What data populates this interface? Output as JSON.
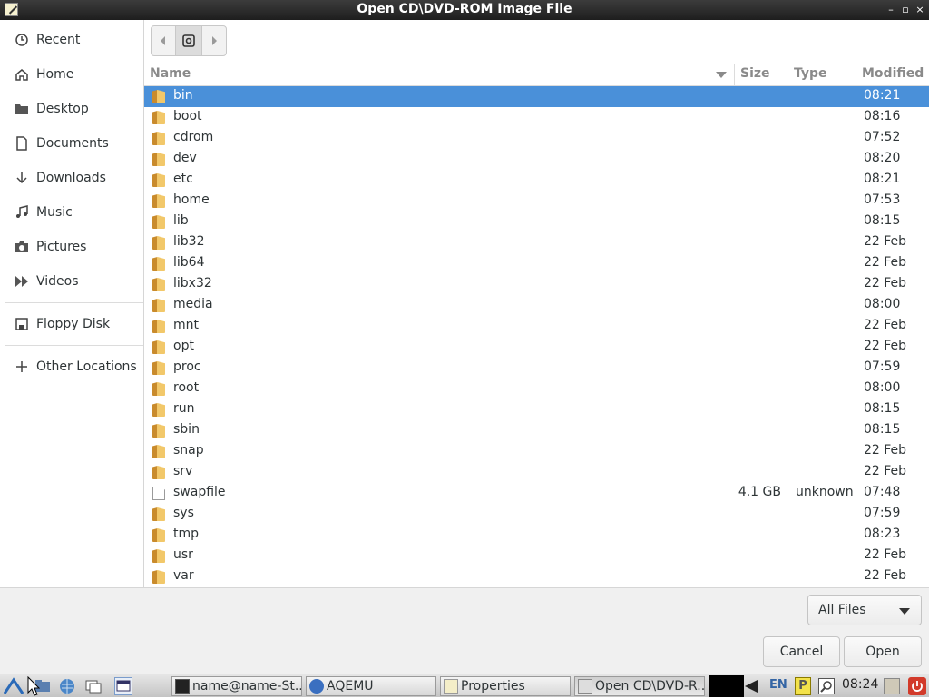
{
  "window": {
    "title": "Open CD\\DVD-ROM Image File",
    "controls": [
      "–",
      "▫",
      "×"
    ]
  },
  "sidebar": {
    "items": [
      {
        "label": "Recent",
        "icon": "clock-icon"
      },
      {
        "label": "Home",
        "icon": "home-icon"
      },
      {
        "label": "Desktop",
        "icon": "folder-icon"
      },
      {
        "label": "Documents",
        "icon": "document-icon"
      },
      {
        "label": "Downloads",
        "icon": "download-arrow-icon"
      },
      {
        "label": "Music",
        "icon": "music-note-icon"
      },
      {
        "label": "Pictures",
        "icon": "camera-icon"
      },
      {
        "label": "Videos",
        "icon": "video-icon"
      }
    ],
    "devices": [
      {
        "label": "Floppy Disk",
        "icon": "floppy-icon"
      }
    ],
    "other": {
      "label": "Other Locations",
      "icon": "plus-icon"
    }
  },
  "columns": {
    "name": "Name",
    "size": "Size",
    "type": "Type",
    "modified": "Modified"
  },
  "files": [
    {
      "name": "bin",
      "size": "",
      "type": "",
      "modified": "08:21",
      "kind": "folder",
      "selected": true
    },
    {
      "name": "boot",
      "size": "",
      "type": "",
      "modified": "08:16",
      "kind": "folder"
    },
    {
      "name": "cdrom",
      "size": "",
      "type": "",
      "modified": "07:52",
      "kind": "folder"
    },
    {
      "name": "dev",
      "size": "",
      "type": "",
      "modified": "08:20",
      "kind": "folder"
    },
    {
      "name": "etc",
      "size": "",
      "type": "",
      "modified": "08:21",
      "kind": "folder"
    },
    {
      "name": "home",
      "size": "",
      "type": "",
      "modified": "07:53",
      "kind": "folder"
    },
    {
      "name": "lib",
      "size": "",
      "type": "",
      "modified": "08:15",
      "kind": "folder"
    },
    {
      "name": "lib32",
      "size": "",
      "type": "",
      "modified": "22 Feb",
      "kind": "folder"
    },
    {
      "name": "lib64",
      "size": "",
      "type": "",
      "modified": "22 Feb",
      "kind": "folder"
    },
    {
      "name": "libx32",
      "size": "",
      "type": "",
      "modified": "22 Feb",
      "kind": "folder"
    },
    {
      "name": "media",
      "size": "",
      "type": "",
      "modified": "08:00",
      "kind": "folder"
    },
    {
      "name": "mnt",
      "size": "",
      "type": "",
      "modified": "22 Feb",
      "kind": "folder"
    },
    {
      "name": "opt",
      "size": "",
      "type": "",
      "modified": "22 Feb",
      "kind": "folder"
    },
    {
      "name": "proc",
      "size": "",
      "type": "",
      "modified": "07:59",
      "kind": "folder"
    },
    {
      "name": "root",
      "size": "",
      "type": "",
      "modified": "08:00",
      "kind": "folder"
    },
    {
      "name": "run",
      "size": "",
      "type": "",
      "modified": "08:15",
      "kind": "folder"
    },
    {
      "name": "sbin",
      "size": "",
      "type": "",
      "modified": "08:15",
      "kind": "folder"
    },
    {
      "name": "snap",
      "size": "",
      "type": "",
      "modified": "22 Feb",
      "kind": "folder"
    },
    {
      "name": "srv",
      "size": "",
      "type": "",
      "modified": "22 Feb",
      "kind": "folder"
    },
    {
      "name": "swapfile",
      "size": "4.1 GB",
      "type": "unknown",
      "modified": "07:48",
      "kind": "file"
    },
    {
      "name": "sys",
      "size": "",
      "type": "",
      "modified": "07:59",
      "kind": "folder"
    },
    {
      "name": "tmp",
      "size": "",
      "type": "",
      "modified": "08:23",
      "kind": "folder"
    },
    {
      "name": "usr",
      "size": "",
      "type": "",
      "modified": "22 Feb",
      "kind": "folder"
    },
    {
      "name": "var",
      "size": "",
      "type": "",
      "modified": "22 Feb",
      "kind": "folder"
    }
  ],
  "filter": {
    "selected": "All Files"
  },
  "buttons": {
    "cancel": "Cancel",
    "open": "Open"
  },
  "taskbar": {
    "tasks": [
      {
        "label": "name@name-St..."
      },
      {
        "label": "AQEMU"
      },
      {
        "label": "Properties"
      },
      {
        "label": "Open CD\\DVD-R..."
      }
    ],
    "lang": "EN",
    "clock": "08:24"
  },
  "colors": {
    "selection": "#4a90d9",
    "titlebar": "#2a2a2a"
  }
}
